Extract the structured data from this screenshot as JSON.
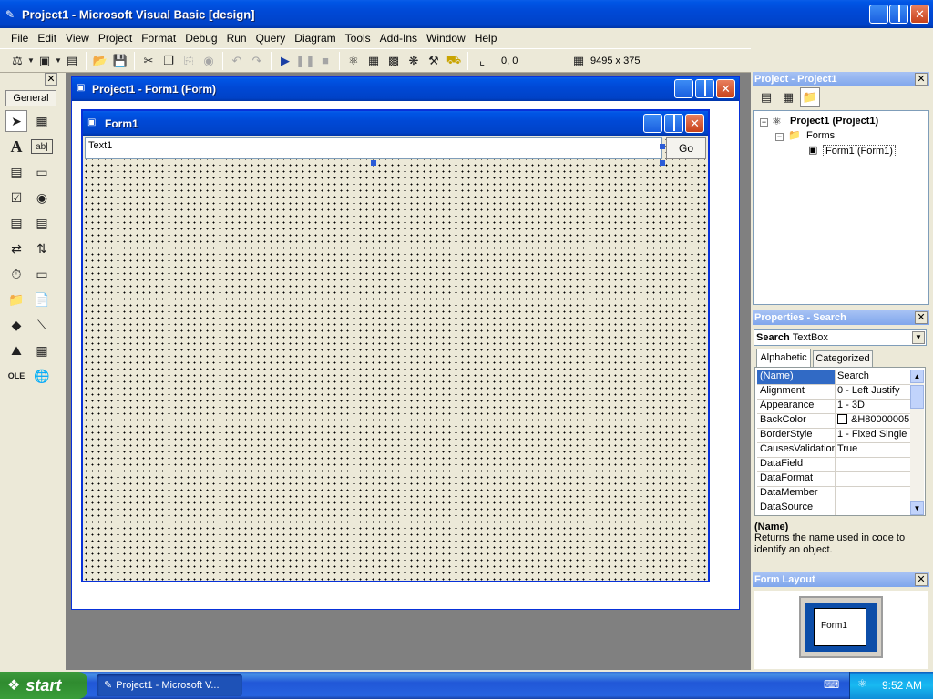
{
  "app": {
    "title": "Project1 - Microsoft Visual Basic [design]"
  },
  "menu": [
    "File",
    "Edit",
    "View",
    "Project",
    "Format",
    "Debug",
    "Run",
    "Query",
    "Diagram",
    "Tools",
    "Add-Ins",
    "Window",
    "Help"
  ],
  "toolbar": {
    "position": "0, 0",
    "size": "9495 x 375"
  },
  "toolbox": {
    "tab": "General"
  },
  "form_window": {
    "title": "Project1 - Form1 (Form)"
  },
  "form": {
    "title": "Form1",
    "textbox_value": "Text1",
    "button_label": "Go"
  },
  "project_explorer": {
    "title": "Project - Project1",
    "root": "Project1 (Project1)",
    "folder": "Forms",
    "item": "Form1 (Form1)"
  },
  "properties": {
    "title": "Properties - Search",
    "object_name": "Search",
    "object_type": "TextBox",
    "tab_alpha": "Alphabetic",
    "tab_cat": "Categorized",
    "rows": [
      {
        "name": "(Name)",
        "value": "Search"
      },
      {
        "name": "Alignment",
        "value": "0 - Left Justify"
      },
      {
        "name": "Appearance",
        "value": "1 - 3D"
      },
      {
        "name": "BackColor",
        "value": "&H80000005"
      },
      {
        "name": "BorderStyle",
        "value": "1 - Fixed Single"
      },
      {
        "name": "CausesValidation",
        "value": "True"
      },
      {
        "name": "DataField",
        "value": ""
      },
      {
        "name": "DataFormat",
        "value": ""
      },
      {
        "name": "DataMember",
        "value": ""
      },
      {
        "name": "DataSource",
        "value": ""
      }
    ],
    "desc_title": "(Name)",
    "desc_text": "Returns the name used in code to identify an object."
  },
  "form_layout": {
    "title": "Form Layout",
    "preview_label": "Form1"
  },
  "taskbar": {
    "start_label": "start",
    "task_label": "Project1 - Microsoft V...",
    "clock": "9:52 AM"
  },
  "colors": {
    "xp_blue": "#0049d6",
    "form_bg": "#ece9d8",
    "selection": "#316ac5"
  }
}
